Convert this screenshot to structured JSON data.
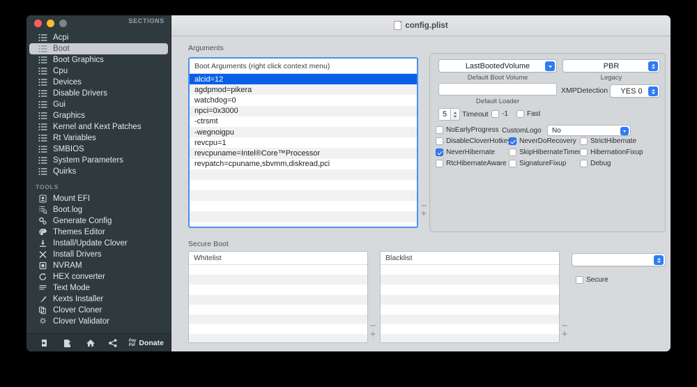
{
  "window": {
    "sidebar_header": "SECTIONS",
    "title": "config.plist",
    "title_icon": "document-icon"
  },
  "sidebar": {
    "sections_label": "SECTIONS",
    "sections": [
      {
        "label": "Acpi",
        "icon": "list-icon",
        "selected": false
      },
      {
        "label": "Boot",
        "icon": "list-icon",
        "selected": true
      },
      {
        "label": "Boot Graphics",
        "icon": "list-icon",
        "selected": false
      },
      {
        "label": "Cpu",
        "icon": "list-icon",
        "selected": false
      },
      {
        "label": "Devices",
        "icon": "list-icon",
        "selected": false
      },
      {
        "label": "Disable Drivers",
        "icon": "list-icon",
        "selected": false
      },
      {
        "label": "Gui",
        "icon": "list-icon",
        "selected": false
      },
      {
        "label": "Graphics",
        "icon": "list-icon",
        "selected": false
      },
      {
        "label": "Kernel and Kext Patches",
        "icon": "list-icon",
        "selected": false
      },
      {
        "label": "Rt Variables",
        "icon": "list-icon",
        "selected": false
      },
      {
        "label": "SMBIOS",
        "icon": "list-icon",
        "selected": false
      },
      {
        "label": "System Parameters",
        "icon": "list-icon",
        "selected": false
      },
      {
        "label": "Quirks",
        "icon": "list-icon",
        "selected": false
      }
    ],
    "tools_label": "TOOLS",
    "tools": [
      {
        "label": "Mount EFI",
        "icon": "drive-icon"
      },
      {
        "label": "Boot.log",
        "icon": "log-search-icon"
      },
      {
        "label": "Generate Config",
        "icon": "gears-icon"
      },
      {
        "label": "Themes Editor",
        "icon": "palette-icon"
      },
      {
        "label": "Install/Update Clover",
        "icon": "download-icon"
      },
      {
        "label": "Install Drivers",
        "icon": "tools-icon"
      },
      {
        "label": "NVRAM",
        "icon": "chip-icon"
      },
      {
        "label": "HEX converter",
        "icon": "refresh-icon"
      },
      {
        "label": "Text Mode",
        "icon": "text-lines-icon"
      },
      {
        "label": "Kexts Installer",
        "icon": "plug-icon"
      },
      {
        "label": "Clover Cloner",
        "icon": "copy-icon"
      },
      {
        "label": "Clover Validator",
        "icon": "bulb-icon"
      }
    ],
    "toolbar": [
      {
        "name": "import-button",
        "icon": "arrow-into-box-icon",
        "label": ""
      },
      {
        "name": "export-button",
        "icon": "arrow-out-box-icon",
        "label": ""
      },
      {
        "name": "home-button",
        "icon": "home-icon",
        "label": ""
      },
      {
        "name": "share-button",
        "icon": "share-icon",
        "label": ""
      }
    ],
    "donate": {
      "label": "Donate",
      "brand_line1": "Pay",
      "brand_line2": "Pal"
    }
  },
  "arguments_section": {
    "label": "Arguments",
    "list_header": "Boot Arguments (right click context menu)",
    "items": [
      {
        "text": "alcid=12",
        "selected": true
      },
      {
        "text": "agdpmod=pikera",
        "selected": false
      },
      {
        "text": "watchdog=0",
        "selected": false
      },
      {
        "text": "npci=0x3000",
        "selected": false
      },
      {
        "text": "-ctrsmt",
        "selected": false
      },
      {
        "text": "-wegnoigpu",
        "selected": false
      },
      {
        "text": "revcpu=1",
        "selected": false
      },
      {
        "text": "revcpuname=Intel®Core™Processor",
        "selected": false
      },
      {
        "text": "revpatch=cpuname,sbvmm,diskread,pci",
        "selected": false
      }
    ],
    "remove_label": "−",
    "add_label": "+"
  },
  "boot_settings": {
    "default_boot_volume": {
      "value": "LastBootedVolume",
      "caption": "Default Boot Volume"
    },
    "legacy": {
      "value": "PBR",
      "caption": "Legacy"
    },
    "default_loader": {
      "value": "",
      "caption": "Default Loader"
    },
    "xmp_detection": {
      "label": "XMPDetection",
      "value": "YES 0"
    },
    "timeout": {
      "value": "5",
      "label": "Timeout"
    },
    "timeout_minus_one": {
      "label": "-1",
      "checked": false
    },
    "fast": {
      "label": "Fast",
      "checked": false
    },
    "custom_logo": {
      "label": "CustomLogo",
      "value": "No"
    },
    "checkboxes": [
      {
        "label": "NoEarlyProgress",
        "checked": false
      },
      {
        "label": "DisableCloverHotkeys",
        "checked": false
      },
      {
        "label": "NeverHibernate",
        "checked": true
      },
      {
        "label": "RtcHibernateAware",
        "checked": false
      },
      {
        "label": "NeverDoRecovery",
        "checked": true
      },
      {
        "label": "SkipHibernateTimeout",
        "checked": false
      },
      {
        "label": "SignatureFixup",
        "checked": false
      },
      {
        "label": "StrictHibernate",
        "checked": false
      },
      {
        "label": "HibernationFixup",
        "checked": false
      },
      {
        "label": "Debug",
        "checked": false
      }
    ]
  },
  "secure_boot": {
    "label": "Secure Boot",
    "whitelist": {
      "header": "Whitelist",
      "rows": []
    },
    "blacklist": {
      "header": "Blacklist",
      "rows": []
    },
    "policy": {
      "value": ""
    },
    "secure": {
      "label": "Secure",
      "checked": false
    },
    "remove_label": "−",
    "add_label": "+"
  }
}
